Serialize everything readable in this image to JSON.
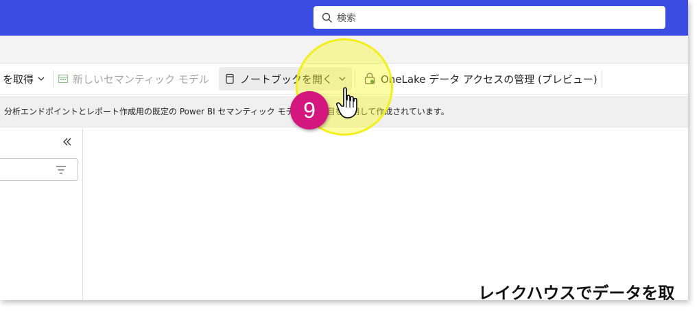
{
  "header": {
    "search_placeholder": "検索"
  },
  "toolbar": {
    "get_data_label": "を取得",
    "new_semantic_model_label": "新しいセマンティック モデル",
    "open_notebook_label": "ノートブックを開く",
    "onelake_access_label": "OneLake データ アクセスの管理 (プレビュー)"
  },
  "infobar": {
    "message": "分析エンドポイントとレポート作成用の既定の Power BI セマンティック モデルは、項目を使用して作成されています。"
  },
  "main": {
    "heading": "レイクハウスでデータを取"
  },
  "annotation": {
    "step_number": "9"
  },
  "colors": {
    "topbar": "#3b4ce2",
    "highlight": "#f2ef1c",
    "badge": "#d4177f"
  }
}
